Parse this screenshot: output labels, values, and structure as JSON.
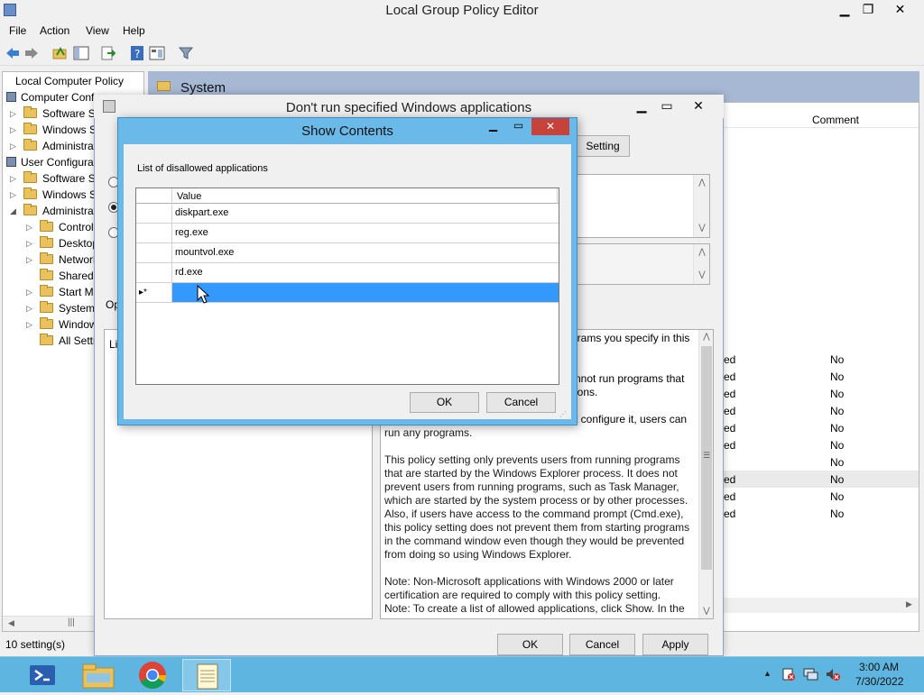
{
  "main": {
    "title": "Local Group Policy Editor",
    "menu": [
      "File",
      "Action",
      "View",
      "Help"
    ],
    "tree": [
      {
        "label": "Local Computer Policy",
        "depth": 0,
        "twisty": ""
      },
      {
        "label": "Computer Conf",
        "depth": 1,
        "twisty": ""
      },
      {
        "label": "Software Se",
        "depth": 2,
        "twisty": "▷"
      },
      {
        "label": "Windows Se",
        "depth": 2,
        "twisty": "▷"
      },
      {
        "label": "Administrati",
        "depth": 2,
        "twisty": "▷"
      },
      {
        "label": "User Configurat",
        "depth": 1,
        "twisty": ""
      },
      {
        "label": "Software Se",
        "depth": 2,
        "twisty": "▷"
      },
      {
        "label": "Windows Se",
        "depth": 2,
        "twisty": "▷"
      },
      {
        "label": "Administrati",
        "depth": 2,
        "twisty": "◢"
      },
      {
        "label": "Control",
        "depth": 3,
        "twisty": "▷"
      },
      {
        "label": "Desktop",
        "depth": 3,
        "twisty": "▷"
      },
      {
        "label": "Network",
        "depth": 3,
        "twisty": "▷"
      },
      {
        "label": "Shared F",
        "depth": 3,
        "twisty": ""
      },
      {
        "label": "Start Me",
        "depth": 3,
        "twisty": "▷"
      },
      {
        "label": "System",
        "depth": 3,
        "twisty": "▷"
      },
      {
        "label": "Window",
        "depth": 3,
        "twisty": "▷"
      },
      {
        "label": "All Settin",
        "depth": 3,
        "twisty": ""
      }
    ],
    "right_header": "System",
    "comment_col": "Comment",
    "rows": [
      {
        "state": "ed",
        "comment": "No"
      },
      {
        "state": "ed",
        "comment": "No"
      },
      {
        "state": "ed",
        "comment": "No"
      },
      {
        "state": "ed",
        "comment": "No"
      },
      {
        "state": "ed",
        "comment": "No"
      },
      {
        "state": "ed",
        "comment": "No"
      },
      {
        "state": "",
        "comment": "No"
      },
      {
        "state": "ed",
        "comment": "No"
      },
      {
        "state": "ed",
        "comment": "No"
      },
      {
        "state": "ed",
        "comment": "No"
      }
    ],
    "status": "10 setting(s)"
  },
  "policy": {
    "title": "Don't run specified Windows applications",
    "setting_btn": "Setting",
    "op_label": "Op",
    "li_label": "Li",
    "help_top": "grams you specify in this",
    "help_frag1": "nnot run programs that",
    "help_frag2": "ions.",
    "help_frag3": "t configure it, users can",
    "help_line": "run any programs.",
    "help_p1": "This policy setting only prevents users from running programs that are started by the Windows Explorer process. It does not prevent users from running programs, such as Task Manager, which are started by the system process or by other processes. Also, if users have access to the command prompt (Cmd.exe), this policy setting does not prevent them from starting programs in the command window even though they would be prevented from doing so using Windows Explorer.",
    "help_p2": "Note: Non-Microsoft applications with Windows 2000 or later certification are required to comply with this policy setting.",
    "help_p3": "Note: To create a list of allowed applications, click Show.  In the",
    "ok": "OK",
    "cancel": "Cancel",
    "apply": "Apply"
  },
  "show_contents": {
    "title": "Show Contents",
    "list_label": "List of disallowed applications",
    "column": "Value",
    "values": [
      "diskpart.exe",
      "reg.exe",
      "mountvol.exe",
      "rd.exe"
    ],
    "new_row_marker": "▸*",
    "ok": "OK",
    "cancel": "Cancel"
  },
  "taskbar": {
    "time": "3:00 AM",
    "date": "7/30/2022"
  },
  "colors": {
    "selection": "#3399ff",
    "taskbar": "#5db5e0",
    "close_red": "#c7423b",
    "header_blue": "#a7b8d4"
  }
}
